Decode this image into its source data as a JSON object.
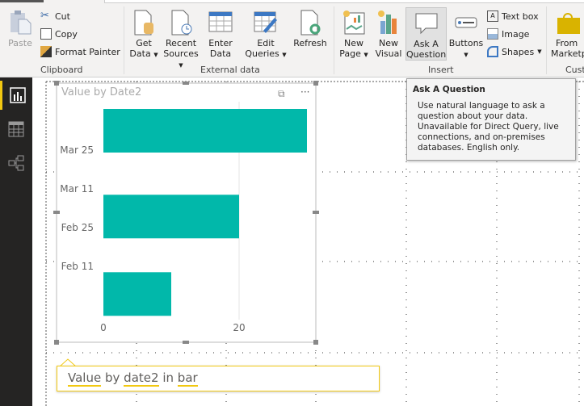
{
  "ribbon": {
    "clipboard": {
      "label": "Clipboard",
      "paste": "Paste",
      "cut": "Cut",
      "copy": "Copy",
      "format_painter": "Format Painter"
    },
    "external_data": {
      "label": "External data",
      "get_data": [
        "Get",
        "Data"
      ],
      "recent_sources": [
        "Recent",
        "Sources"
      ],
      "enter_data": [
        "Enter",
        "Data"
      ],
      "edit_queries": [
        "Edit",
        "Queries"
      ],
      "refresh": "Refresh"
    },
    "insert": {
      "label": "Insert",
      "new_page": [
        "New",
        "Page"
      ],
      "new_visual": [
        "New",
        "Visual"
      ],
      "ask_question": [
        "Ask A",
        "Question"
      ],
      "buttons": "Buttons",
      "text_box": "Text box",
      "image": "Image",
      "shapes": "Shapes"
    },
    "custom": {
      "label": "Cust",
      "from_marketplace": [
        "From",
        "Marketp"
      ]
    }
  },
  "sidebar": {
    "items": [
      {
        "icon": "report-icon",
        "active": true
      },
      {
        "icon": "data-icon"
      },
      {
        "icon": "relationships-icon"
      }
    ]
  },
  "tooltip": {
    "title": "Ask A Question",
    "body": "Use natural language to ask a question about your data. Unavailable for Direct Query, live connections, and on-premises databases. English only."
  },
  "qa": {
    "words": [
      "Value",
      "by",
      "date2",
      "in",
      "bar"
    ]
  },
  "colors": {
    "bar": "#01b8aa",
    "accent": "#f2c811",
    "sidebar": "#252423"
  },
  "chart_data": {
    "type": "bar",
    "orientation": "horizontal",
    "title": "Value by Date2",
    "categories": [
      "2018-04-01",
      "2018-03-01",
      "2018-02-01"
    ],
    "values": [
      30,
      20,
      10
    ],
    "y_tick_labels": [
      "Mar 25",
      "Mar 11",
      "Feb 25",
      "Feb 11"
    ],
    "x_tick_labels": [
      "0",
      "20"
    ],
    "xlim": [
      0,
      30
    ],
    "grid": true
  }
}
